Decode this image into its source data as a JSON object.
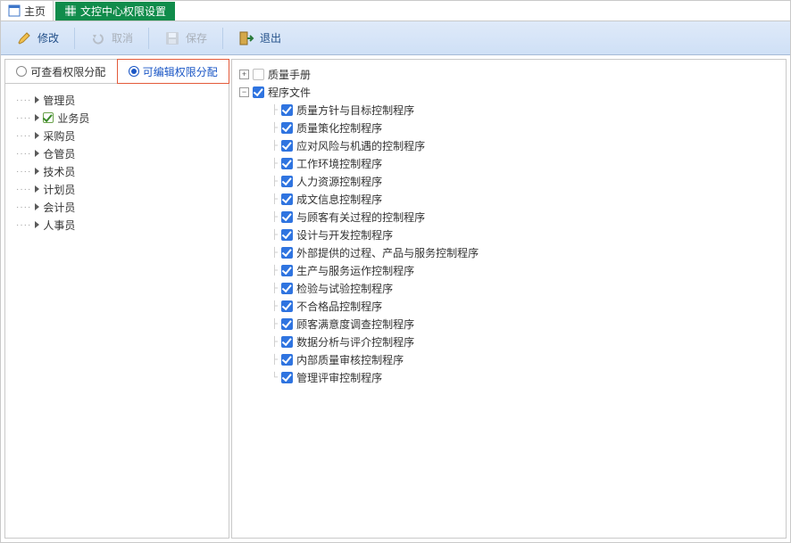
{
  "tabs": {
    "home": "主页",
    "permissions": "文控中心权限设置"
  },
  "toolbar": {
    "modify": "修改",
    "cancel": "取消",
    "save": "保存",
    "exit": "退出"
  },
  "radios": {
    "view": "可查看权限分配",
    "edit": "可编辑权限分配"
  },
  "roles": [
    {
      "label": "管理员",
      "checked": false
    },
    {
      "label": "业务员",
      "checked": true
    },
    {
      "label": "采购员",
      "checked": false
    },
    {
      "label": "仓管员",
      "checked": false
    },
    {
      "label": "技术员",
      "checked": false
    },
    {
      "label": "计划员",
      "checked": false
    },
    {
      "label": "会计员",
      "checked": false
    },
    {
      "label": "人事员",
      "checked": false
    }
  ],
  "tree": {
    "node0": {
      "label": "质量手册",
      "checked": false,
      "expander": "+"
    },
    "node1": {
      "label": "程序文件",
      "checked": true,
      "expander": "−"
    },
    "children": [
      "质量方针与目标控制程序",
      "质量策化控制程序",
      "应对风险与机遇的控制程序",
      "工作环境控制程序",
      "人力资源控制程序",
      "成文信息控制程序",
      "与顾客有关过程的控制程序",
      "设计与开发控制程序",
      "外部提供的过程、产品与服务控制程序",
      "生产与服务运作控制程序",
      "检验与试验控制程序",
      "不合格品控制程序",
      "顾客满意度调查控制程序",
      "数据分析与评介控制程序",
      "内部质量审核控制程序",
      "管理评审控制程序"
    ]
  }
}
